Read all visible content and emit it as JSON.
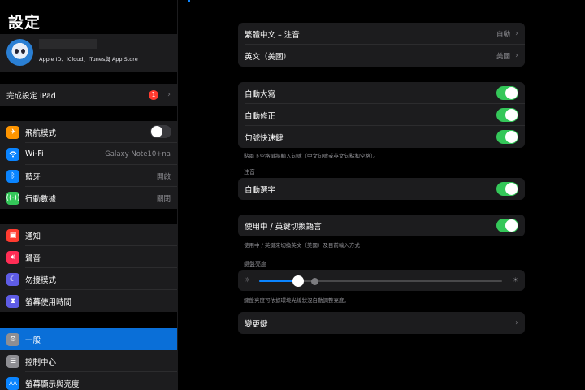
{
  "sidebar": {
    "title": "設定",
    "profile": {
      "subtitle": "Apple ID、iCloud、iTunes與 App Store"
    },
    "finish_setup": {
      "label": "完成設定 iPad",
      "badge": "1"
    },
    "items_connectivity": [
      {
        "label": "飛航模式",
        "icon": "airplane-icon",
        "color": "#ff9500",
        "value": "",
        "toggle": false
      },
      {
        "label": "Wi-Fi",
        "icon": "wifi-icon",
        "color": "#0a84ff",
        "value": "Galaxy Note10+na"
      },
      {
        "label": "藍牙",
        "icon": "bluetooth-icon",
        "color": "#0a84ff",
        "value": "開啟"
      },
      {
        "label": "行動數據",
        "icon": "antenna-icon",
        "color": "#34c759",
        "value": "關閉"
      }
    ],
    "items_notifications": [
      {
        "label": "通知",
        "icon": "notifications-icon",
        "color": "#ff3b30"
      },
      {
        "label": "聲音",
        "icon": "speaker-icon",
        "color": "#ff2d55"
      },
      {
        "label": "勿擾模式",
        "icon": "moon-icon",
        "color": "#5e5ce6"
      },
      {
        "label": "螢幕使用時間",
        "icon": "hourglass-icon",
        "color": "#5e5ce6"
      }
    ],
    "items_general": [
      {
        "label": "一般",
        "icon": "gear-icon",
        "color": "#8e8e93",
        "selected": true
      },
      {
        "label": "控制中心",
        "icon": "switches-icon",
        "color": "#8e8e93"
      },
      {
        "label": "螢幕顯示與亮度",
        "icon": "text-size-icon",
        "color": "#0a84ff"
      }
    ]
  },
  "main": {
    "languages": [
      {
        "label": "繁體中文 – 注音",
        "value": "自動"
      },
      {
        "label": "英文（美國）",
        "value": "美國"
      }
    ],
    "toggles": [
      {
        "label": "自動大寫",
        "on": true
      },
      {
        "label": "自動修正",
        "on": true
      },
      {
        "label": "句號快速鍵",
        "on": true
      }
    ],
    "period_footnote": "點兩下空格鍵將輸入句號（中文句號或英文句點和空格）。",
    "zhuyin_header": "注音",
    "zhuyin_toggle": {
      "label": "自動選字",
      "on": true
    },
    "switch_toggle": {
      "label": "使用中 / 英鍵切換語言",
      "on": true
    },
    "switch_footnote": "使用中 / 英鍵來切換英文（美國）及目前輸入方式",
    "brightness_header": "鍵盤亮度",
    "brightness_level": 0.16,
    "brightness_footnote": "鍵盤亮度可依據環境光線狀況自動調整亮度。",
    "modifier_label": "變更鍵"
  },
  "colors": {
    "accent": "#0a84ff",
    "toggle_on": "#34c759",
    "selected_row": "#0a6fd8",
    "badge": "#ff3b30"
  }
}
